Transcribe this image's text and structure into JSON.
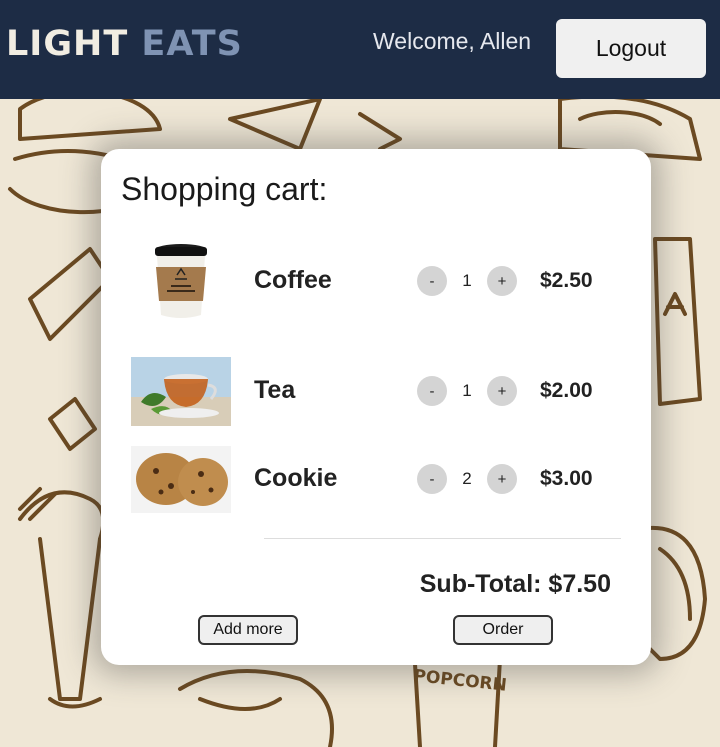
{
  "header": {
    "logo_part1": "LIGHT",
    "logo_part2": "EATS",
    "welcome": "Welcome, Allen",
    "logout_label": "Logout"
  },
  "cart": {
    "title": "Shopping cart:",
    "items": [
      {
        "name": "Coffee",
        "quantity": "1",
        "price": "$2.50",
        "image": "coffee-cup"
      },
      {
        "name": "Tea",
        "quantity": "1",
        "price": "$2.00",
        "image": "tea-cup"
      },
      {
        "name": "Cookie",
        "quantity": "2",
        "price": "$3.00",
        "image": "cookies"
      }
    ],
    "decrement_label": "-",
    "increment_label": "+",
    "subtotal": "Sub-Total: $7.50",
    "add_more_label": "Add more",
    "order_label": "Order"
  },
  "colors": {
    "header_bg": "#1d2c45",
    "logo_accent": "#7f93b3",
    "page_bg": "#efe7d6",
    "doodle_stroke": "#6b4a22"
  }
}
